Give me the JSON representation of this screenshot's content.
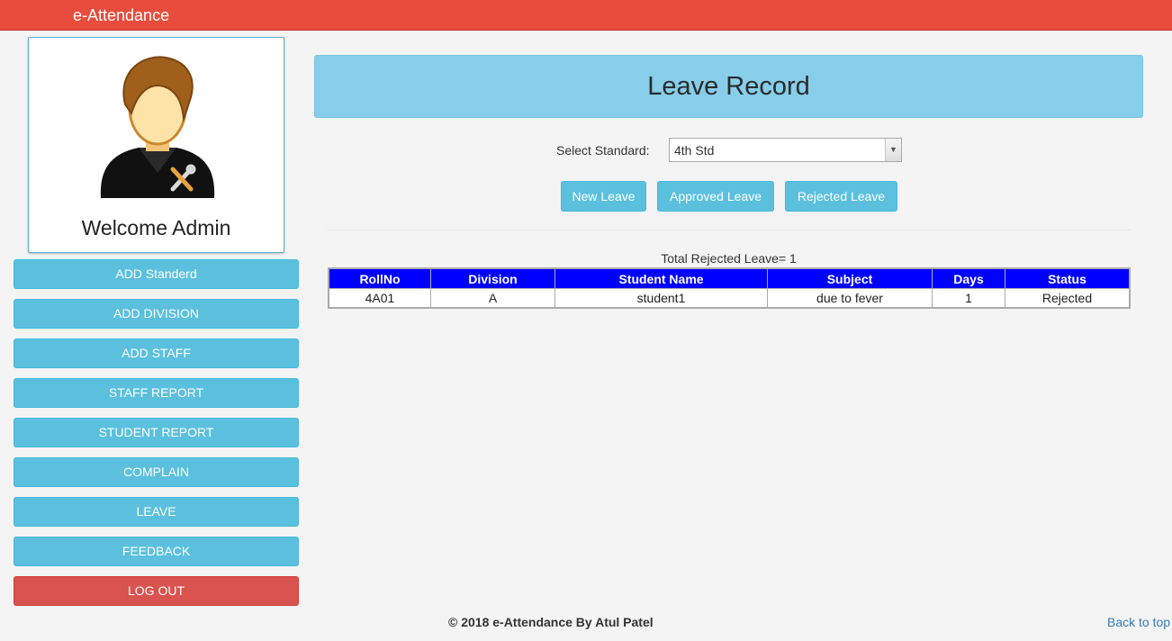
{
  "app": {
    "brand": "e-Attendance"
  },
  "profile": {
    "welcome": "Welcome Admin",
    "avatar_icon": "admin-avatar-icon"
  },
  "sidebar": {
    "items": [
      {
        "label": "ADD Standerd"
      },
      {
        "label": "ADD DIVISION"
      },
      {
        "label": "ADD STAFF"
      },
      {
        "label": "STAFF REPORT"
      },
      {
        "label": "STUDENT REPORT"
      },
      {
        "label": "COMPLAIN"
      },
      {
        "label": "LEAVE"
      },
      {
        "label": "FEEDBACK"
      }
    ],
    "logout": "LOG OUT"
  },
  "main": {
    "title": "Leave Record",
    "select": {
      "label": "Select Standard:",
      "value": "4th Std"
    },
    "buttons": {
      "new": "New Leave",
      "approved": "Approved Leave",
      "rejected": "Rejected Leave"
    },
    "total": "Total Rejected Leave= 1",
    "table": {
      "headers": [
        "RollNo",
        "Division",
        "Student Name",
        "Subject",
        "Days",
        "Status"
      ],
      "rows": [
        [
          "4A01",
          "A",
          "student1",
          "due to fever",
          "1",
          "Rejected"
        ]
      ]
    }
  },
  "footer": {
    "copyright": "© 2018 e-Attendance By Atul Patel",
    "back_to_top": "Back to top"
  },
  "colors": {
    "topbar": "#e74c3c",
    "button": "#5bc0de",
    "danger": "#d9534f",
    "header_panel": "#87ceeb",
    "table_header": "#0000ff",
    "link": "#337ab7"
  }
}
